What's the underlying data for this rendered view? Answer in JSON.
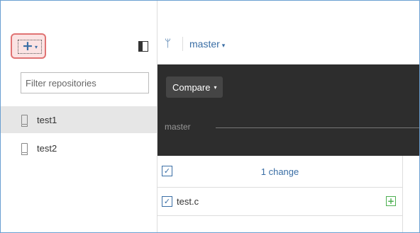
{
  "sidebar": {
    "add_icon": "plus-icon",
    "add_caret": "▾",
    "toggle_icon": "sidebar-toggle-icon",
    "filter_placeholder": "Filter repositories",
    "repos": [
      {
        "name": "test1",
        "selected": true
      },
      {
        "name": "test2",
        "selected": false
      }
    ]
  },
  "topbar": {
    "branch_icon": "branch-icon",
    "branch_name": "master",
    "branch_caret": "▾"
  },
  "history": {
    "compare_label": "Compare",
    "compare_caret": "▾",
    "timeline_branch": "master"
  },
  "changes": {
    "count_label": "1 change",
    "files": [
      {
        "name": "test.c",
        "status_icon": "added-icon"
      }
    ]
  },
  "colors": {
    "accent": "#3a6ea5",
    "highlight_border": "#e07373",
    "dark_panel": "#2d2d2d",
    "added": "#4caf50"
  }
}
